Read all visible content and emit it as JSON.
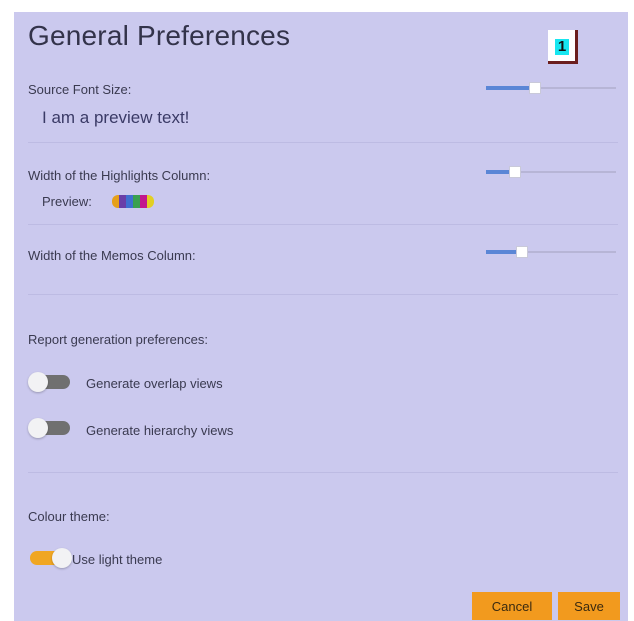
{
  "dialog": {
    "title": "General Preferences",
    "badge": "1"
  },
  "font_size": {
    "label": "Source Font Size:",
    "preview_text": "I am a preview text!",
    "slider_value": 0.38
  },
  "highlights": {
    "label": "Width of the Highlights Column:",
    "preview_label": "Preview:",
    "slider_value": 0.22,
    "preview_colors": [
      "#e6a01a",
      "#6a3ea8",
      "#3f6fd0",
      "#3aa050",
      "#c2188e",
      "#e2cf23"
    ]
  },
  "memos": {
    "label": "Width of the Memos Column:",
    "slider_value": 0.28
  },
  "report": {
    "label": "Report generation preferences:",
    "overlap_label": "Generate overlap views",
    "overlap_on": false,
    "hierarchy_label": "Generate hierarchy views",
    "hierarchy_on": false
  },
  "theme": {
    "label": "Colour theme:",
    "light_label": "Use light theme",
    "light_on": true
  },
  "buttons": {
    "cancel": "Cancel",
    "save": "Save"
  },
  "colors": {
    "panel_bg": "#cbc9ee",
    "slider_fill": "#5b86d6",
    "toggle_on": "#f0a623",
    "toggle_off": "#707070",
    "button_bg": "#f29a1e"
  }
}
